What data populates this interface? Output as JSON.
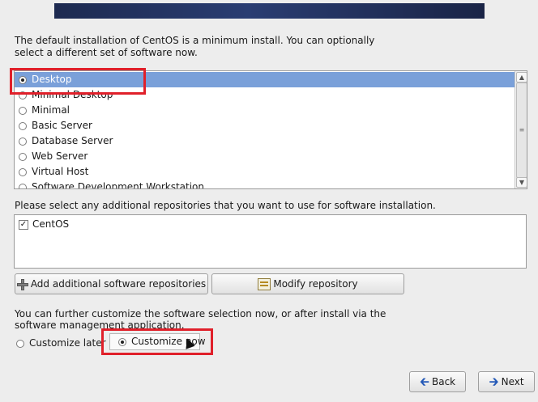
{
  "intro_text": "The default installation of CentOS is a minimum install. You can optionally select a different set of software now.",
  "software_sets": [
    {
      "label": "Desktop",
      "selected": true
    },
    {
      "label": "Minimal Desktop",
      "selected": false
    },
    {
      "label": "Minimal",
      "selected": false
    },
    {
      "label": "Basic Server",
      "selected": false
    },
    {
      "label": "Database Server",
      "selected": false
    },
    {
      "label": "Web Server",
      "selected": false
    },
    {
      "label": "Virtual Host",
      "selected": false
    },
    {
      "label": "Software Development Workstation",
      "selected": false
    }
  ],
  "repositories_prompt": "Please select any additional repositories that you want to use for software installation.",
  "repositories": [
    {
      "label": "CentOS",
      "checked": true
    }
  ],
  "buttons": {
    "add_repo": "Add additional software repositories",
    "modify_repo": "Modify repository",
    "back": "Back",
    "next": "Next"
  },
  "customize_text": "You can further customize the software selection now, or after install via the software management application.",
  "customize_options": {
    "later": "Customize later",
    "now": "Customize now",
    "selected": "now"
  },
  "icons": {
    "add": "plus-icon",
    "modify": "edit-icon",
    "back": "arrow-left-icon",
    "next": "arrow-right-icon"
  },
  "colors": {
    "selection": "#7aa0d9",
    "highlight_box": "#e0202a"
  }
}
